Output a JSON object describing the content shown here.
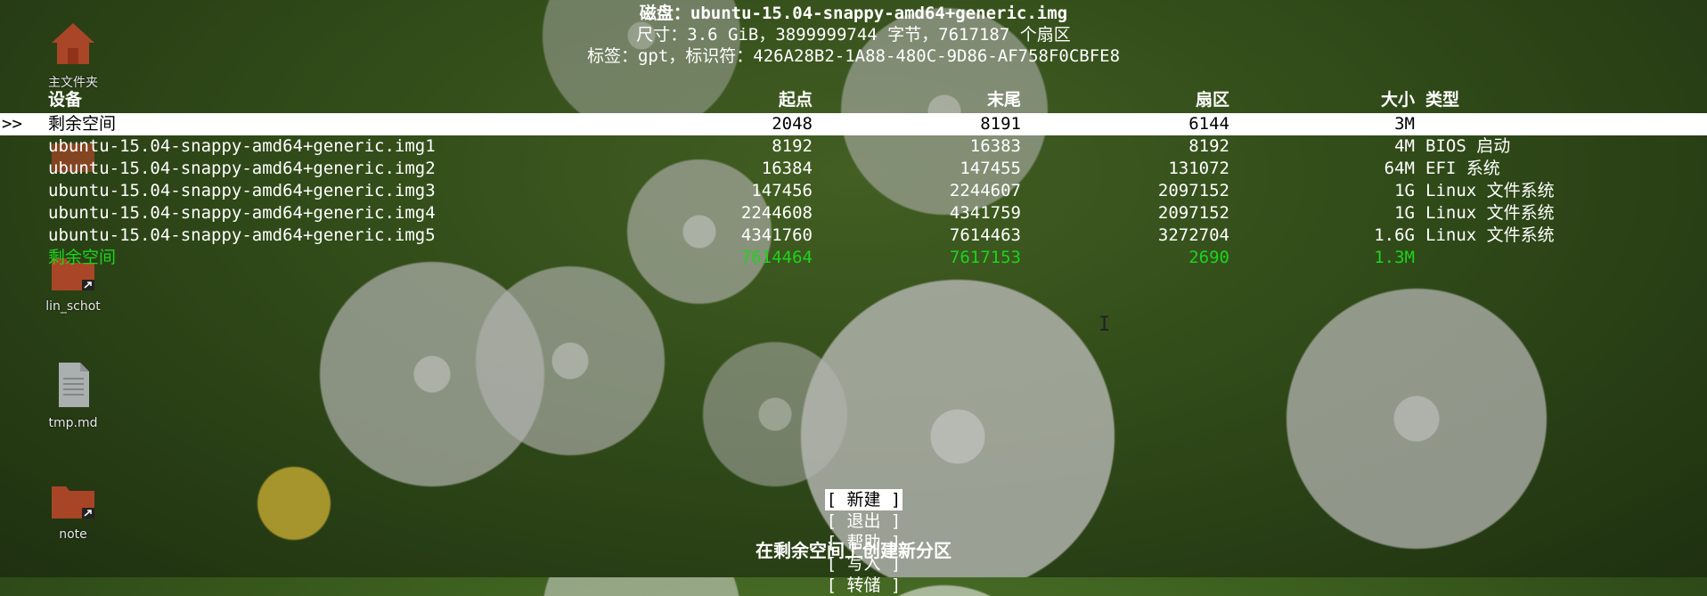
{
  "disk": {
    "title": "磁盘：ubuntu-15.04-snappy-amd64+generic.img",
    "size_line": "尺寸：3.6 GiB，3899999744 字节，7617187 个扇区",
    "label_line": "标签：gpt，标识符：426A28B2-1A88-480C-9D86-AF758F0CBFE8"
  },
  "table": {
    "headers": {
      "device": "设备",
      "start": "起点",
      "end": "末尾",
      "sectors": "扇区",
      "size": "大小",
      "type": "类型"
    },
    "selector": ">>",
    "rows": [
      {
        "device": "剩余空间",
        "start": "2048",
        "end": "8191",
        "sectors": "6144",
        "size": "3M",
        "type": ""
      },
      {
        "device": "ubuntu-15.04-snappy-amd64+generic.img1",
        "start": "8192",
        "end": "16383",
        "sectors": "8192",
        "size": "4M",
        "type": "BIOS 启动"
      },
      {
        "device": "ubuntu-15.04-snappy-amd64+generic.img2",
        "start": "16384",
        "end": "147455",
        "sectors": "131072",
        "size": "64M",
        "type": "EFI 系统"
      },
      {
        "device": "ubuntu-15.04-snappy-amd64+generic.img3",
        "start": "147456",
        "end": "2244607",
        "sectors": "2097152",
        "size": "1G",
        "type": "Linux 文件系统"
      },
      {
        "device": "ubuntu-15.04-snappy-amd64+generic.img4",
        "start": "2244608",
        "end": "4341759",
        "sectors": "2097152",
        "size": "1G",
        "type": "Linux 文件系统"
      },
      {
        "device": "ubuntu-15.04-snappy-amd64+generic.img5",
        "start": "4341760",
        "end": "7614463",
        "sectors": "3272704",
        "size": "1.6G",
        "type": "Linux 文件系统"
      },
      {
        "device": "剩余空间",
        "start": "7614464",
        "end": "7617153",
        "sectors": "2690",
        "size": "1.3M",
        "type": ""
      }
    ]
  },
  "menu": {
    "new": "[ 新建 ]",
    "quit": "[ 退出 ]",
    "help": "[ 帮助 ]",
    "write": "[ 写入 ]",
    "dump": "[ 转储 ]"
  },
  "status": "在剩余空间上创建新分区",
  "desktop": {
    "home": "主文件夹",
    "lin_schot": "lin_schot",
    "tmp": "tmp.md",
    "note": "note"
  },
  "colors": {
    "selected_bg": "#ffffff",
    "free_space_text": "#1cd41c",
    "folder": "#c0482a"
  }
}
